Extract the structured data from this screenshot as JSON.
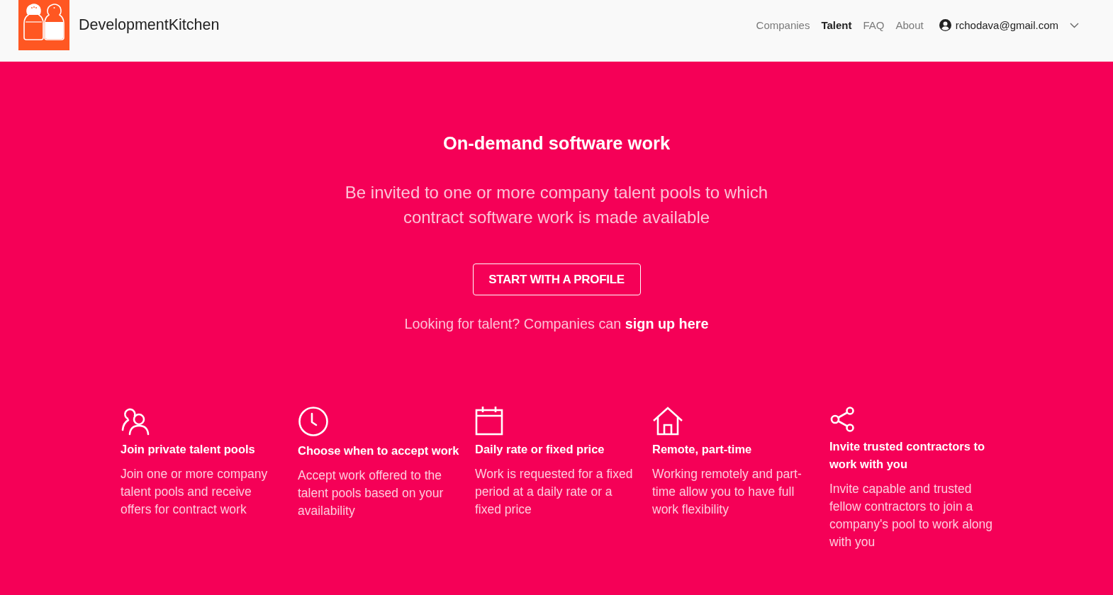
{
  "header": {
    "brand": "DevelopmentKitchen",
    "nav": [
      {
        "label": "Companies",
        "selected": false
      },
      {
        "label": "Talent",
        "selected": true
      },
      {
        "label": "FAQ",
        "selected": false
      },
      {
        "label": "About",
        "selected": false
      }
    ],
    "account": {
      "email": "rchodava@gmail.com"
    }
  },
  "hero": {
    "title": "On-demand software work",
    "subtitle": "Be invited to one or more company talent pools to which contract software work is made available",
    "button": "START WITH A PROFILE",
    "note": {
      "text": "Looking for talent? Companies can ",
      "link": "sign up here"
    }
  },
  "features": [
    {
      "title": "Join private talent pools",
      "text": "Join one or more company talent pools and receive offers for contract work"
    },
    {
      "title": "Choose when to accept work",
      "text": "Accept work offered to the talent pools based on your availability"
    },
    {
      "title": "Daily rate or fixed price",
      "text": "Work is requested for a fixed period at a daily rate or a fixed price"
    },
    {
      "title": "Remote, part-time",
      "text": "Working remotely and part-time allow you to have full work flexibility"
    },
    {
      "title": "Invite trusted contractors to work with you",
      "text": "Invite capable and trusted fellow contractors to join a company's pool to work along with you"
    }
  ]
}
